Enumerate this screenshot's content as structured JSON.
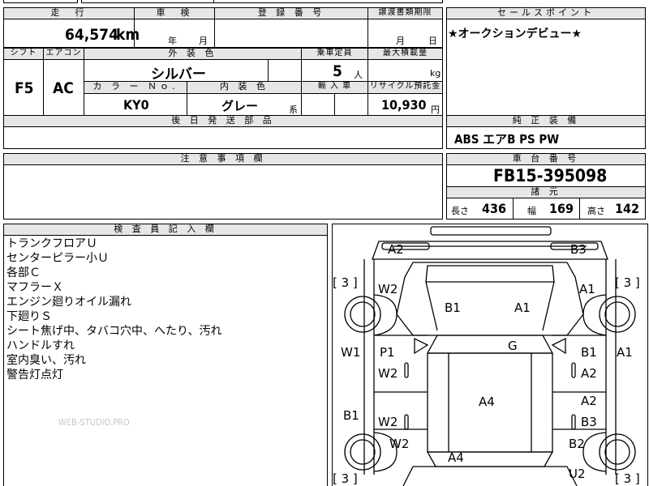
{
  "top": {
    "mileage_header": "走　行",
    "mileage_value": "64,574",
    "mileage_unit": "km",
    "inspection_header": "車　検",
    "inspection_year": "年",
    "inspection_month": "月",
    "registration_header": "登 録 番 号",
    "transfer_header": "譲渡書類期限",
    "transfer_month": "月",
    "transfer_day": "日"
  },
  "specs": {
    "shift_header": "シフト",
    "shift_value": "F5",
    "ac_header": "エアコン",
    "ac_value": "AC",
    "exterior_header": "外 装 色",
    "exterior_value": "シルバー",
    "capacity_header": "乗車定員",
    "capacity_value": "5",
    "capacity_unit": "人",
    "maxload_header": "最大積載量",
    "maxload_unit": "kg",
    "color_no_header": "カ ラ ー Ｎｏ.",
    "color_no_value": "KY0",
    "interior_header": "内 装 色",
    "interior_value": "グレー",
    "interior_suffix": "系",
    "import_header": "輸 入 車",
    "recycle_header": "リサイクル預託金",
    "recycle_value": "10,930",
    "recycle_unit": "円",
    "parts_header": "後 日 発 送 部 品"
  },
  "sales_point": {
    "header": "セールスポイント",
    "text": "★オークションデビュー★"
  },
  "genuine": {
    "header": "純 正 装 備",
    "text": "ABS エアB PS PW"
  },
  "notes": {
    "header": "注 意 事 項 欄"
  },
  "chassis": {
    "header": "車 台 番 号",
    "value": "FB15-395098",
    "specs_header": "諸 元",
    "length_label": "長さ",
    "length_value": "436",
    "width_label": "幅",
    "width_value": "169",
    "height_label": "高さ",
    "height_value": "142"
  },
  "inspector": {
    "header": "検 査 員 記 入 欄",
    "lines": [
      "トランクフロアＵ",
      "センターピラー小Ｕ",
      "各部Ｃ",
      "マフラーＸ",
      "エンジン廻りオイル漏れ",
      "下廻りＳ",
      "シート焦げ中、タバコ穴中、へたり、汚れ",
      "ハンドルすれ",
      "室内臭い、汚れ",
      "警告灯点灯"
    ],
    "watermark": "WEB-STUDIO.PRO"
  },
  "diagram": {
    "labels": {
      "a2_top": "A2",
      "b3_top": "B3",
      "w2_left_front": "W2",
      "a1_right_front": "A1",
      "b1_hood": "B1",
      "a1_hood": "A1",
      "w1_left": "W1",
      "p1": "P1",
      "g_roof": "G",
      "b1_right": "B1",
      "a1_far_right": "A1",
      "w2_left_door1": "W2",
      "a2_right_door1": "A2",
      "a4_roof": "A4",
      "a2_right_door2": "A2",
      "b1_left_lower": "B1",
      "w2_left_door2": "W2",
      "b3_right_door2": "B3",
      "w2_left_rear": "W2",
      "b2_right_rear": "B2",
      "a4_trunk": "A4",
      "u2_rear": "U2"
    },
    "bracket_tl": "[ 3 ]",
    "bracket_tr": "[ 3 ]",
    "bracket_bl": "[ 3 ]",
    "bracket_br": "[ 3 ]"
  }
}
